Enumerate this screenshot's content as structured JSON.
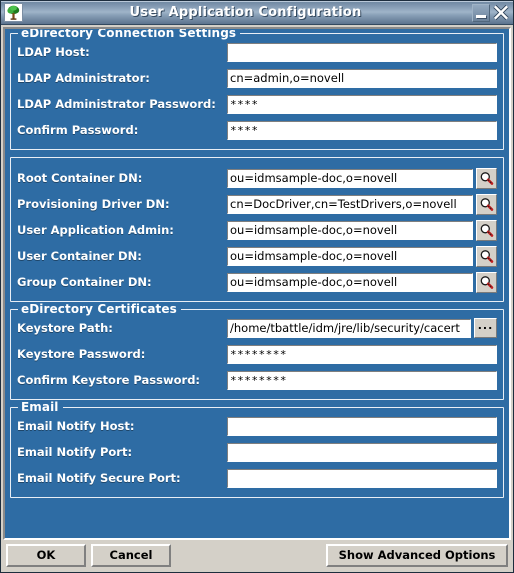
{
  "window": {
    "title": "User Application Configuration",
    "app_icon": "tree-icon",
    "minimize_label": "Minimize",
    "close_label": "Close"
  },
  "colors": {
    "panel_blue": "#2e6ca4",
    "chrome_gray": "#d4d0c8",
    "titlebar_light": "#9fb4c9",
    "titlebar_dark": "#5d748e",
    "field_white": "#ffffff",
    "label_white": "#ffffff"
  },
  "groups": [
    {
      "title": "eDirectory Connection Settings",
      "rows": [
        {
          "label": "LDAP Host:",
          "value": "",
          "type": "text",
          "button": null
        },
        {
          "label": "LDAP Administrator:",
          "value": "cn=admin,o=novell",
          "type": "text",
          "button": null
        },
        {
          "label": "LDAP Administrator Password:",
          "value": "****",
          "type": "password",
          "button": null
        },
        {
          "label": "Confirm Password:",
          "value": "****",
          "type": "password",
          "button": null
        }
      ]
    },
    {
      "title": "",
      "rows": [
        {
          "label": "Root Container DN:",
          "value": "ou=idmsample-doc,o=novell",
          "type": "text",
          "button": "magnifier-icon"
        },
        {
          "label": "Provisioning Driver DN:",
          "value": "cn=DocDriver,cn=TestDrivers,o=novell",
          "type": "text",
          "button": "magnifier-icon"
        },
        {
          "label": "User Application Admin:",
          "value": "ou=idmsample-doc,o=novell",
          "type": "text",
          "button": "magnifier-icon"
        },
        {
          "label": "User Container DN:",
          "value": "ou=idmsample-doc,o=novell",
          "type": "text",
          "button": "magnifier-icon"
        },
        {
          "label": "Group Container DN:",
          "value": "ou=idmsample-doc,o=novell",
          "type": "text",
          "button": "magnifier-icon"
        }
      ]
    },
    {
      "title": "eDirectory Certificates",
      "rows": [
        {
          "label": "Keystore Path:",
          "value": "/home/tbattle/idm/jre/lib/security/cacert",
          "type": "text",
          "button": "ellipsis"
        },
        {
          "label": "Keystore Password:",
          "value": "********",
          "type": "password",
          "button": null
        },
        {
          "label": "Confirm Keystore Password:",
          "value": "********",
          "type": "password",
          "button": null
        }
      ]
    },
    {
      "title": "Email",
      "rows": [
        {
          "label": "Email Notify Host:",
          "value": "",
          "type": "text",
          "button": null
        },
        {
          "label": "Email Notify Port:",
          "value": "",
          "type": "text",
          "button": null
        },
        {
          "label": "Email Notify Secure Port:",
          "value": "",
          "type": "text",
          "button": null
        }
      ]
    }
  ],
  "buttons": {
    "ok": "OK",
    "cancel": "Cancel",
    "advanced": "Show Advanced Options"
  },
  "ellipsis_label": "..."
}
